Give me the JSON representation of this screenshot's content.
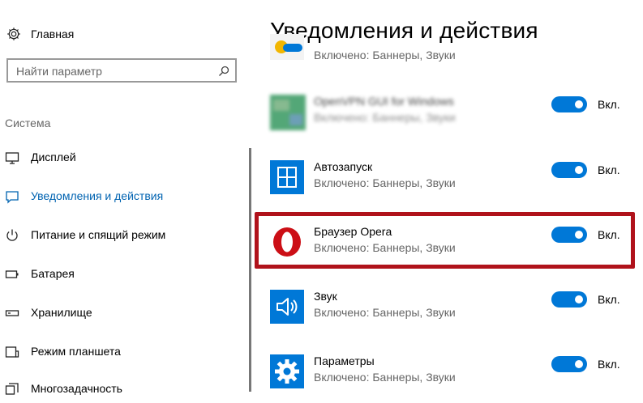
{
  "sidebar": {
    "home_label": "Главная",
    "search_placeholder": "Найти параметр",
    "section_title": "Система",
    "items": [
      {
        "label": "Дисплей",
        "icon": "display-icon"
      },
      {
        "label": "Уведомления и действия",
        "icon": "notifications-icon",
        "active": true
      },
      {
        "label": "Питание и спящий режим",
        "icon": "power-icon"
      },
      {
        "label": "Батарея",
        "icon": "battery-icon"
      },
      {
        "label": "Хранилище",
        "icon": "storage-icon"
      },
      {
        "label": "Режим планшета",
        "icon": "tablet-mode-icon"
      },
      {
        "label": "Многозадачность",
        "icon": "multitasking-icon"
      }
    ]
  },
  "main": {
    "title": "Уведомления и действия",
    "apps": [
      {
        "name": "",
        "status": "Включено: Баннеры, Звуки",
        "toggle": "",
        "icon": "partial-app-icon"
      },
      {
        "name": "OpenVPN GUI for Windows",
        "status": "Включено: Баннеры, Звуки",
        "toggle": "Вкл.",
        "icon": "openvpn-icon",
        "blurred": true
      },
      {
        "name": "Автозапуск",
        "status": "Включено: Баннеры, Звуки",
        "toggle": "Вкл.",
        "icon": "autoplay-icon"
      },
      {
        "name": "Браузер Opera",
        "status": "Включено: Баннеры, Звуки",
        "toggle": "Вкл.",
        "icon": "opera-icon",
        "highlighted": true
      },
      {
        "name": "Звук",
        "status": "Включено: Баннеры, Звуки",
        "toggle": "Вкл.",
        "icon": "sound-icon"
      },
      {
        "name": "Параметры",
        "status": "Включено: Баннеры, Звуки",
        "toggle": "Вкл.",
        "icon": "settings-icon"
      }
    ]
  },
  "colors": {
    "accent": "#0078d7",
    "active_text": "#0063b1",
    "highlight_border": "#b0121b",
    "tile": "#0078d7",
    "opera_red": "#cc0f16"
  }
}
